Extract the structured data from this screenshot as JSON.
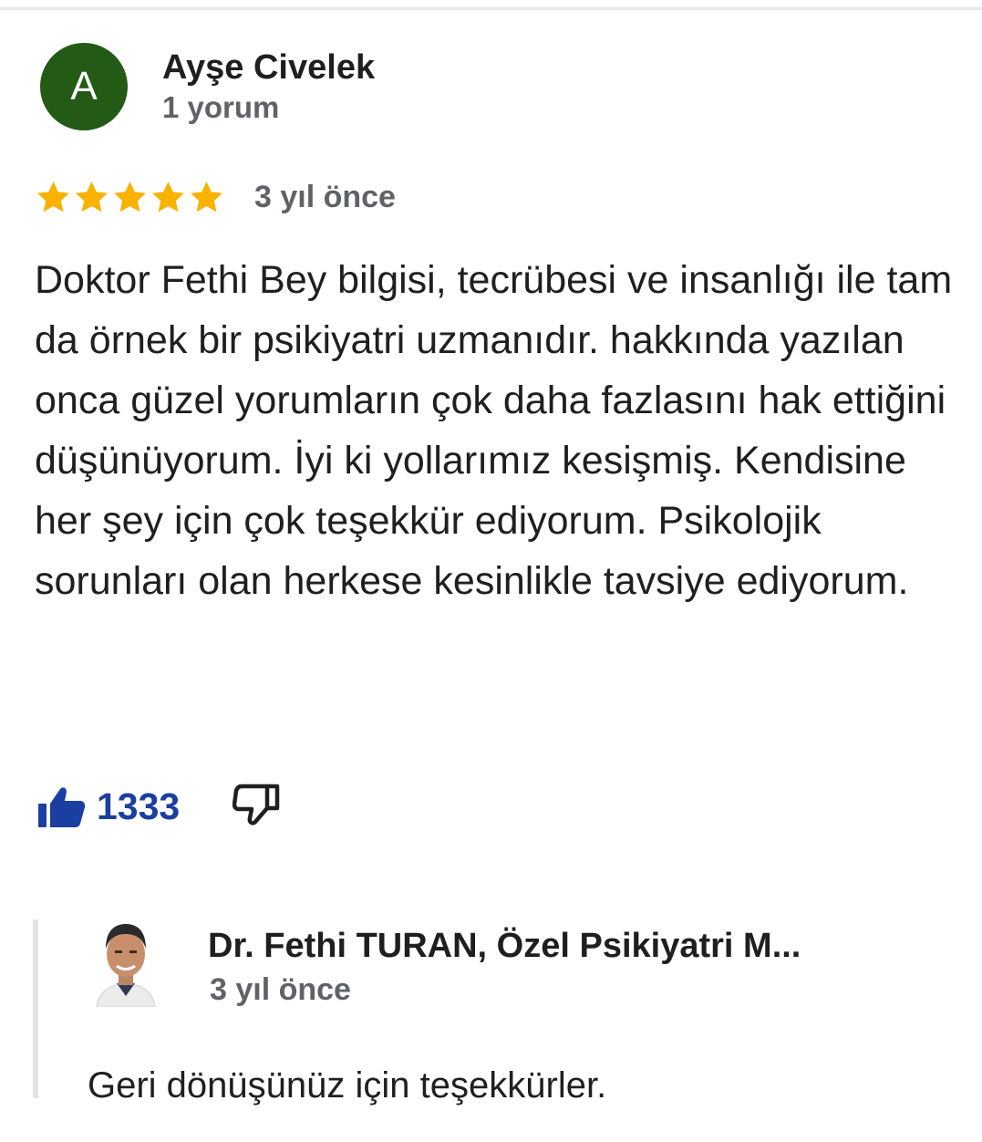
{
  "reviewer": {
    "initial": "A",
    "name": "Ayşe Civelek",
    "review_count": "1 yorum",
    "avatar_color": "#235b16"
  },
  "review": {
    "rating_stars": 5,
    "star_color": "#f9b200",
    "time": "3 yıl önce",
    "text": "Doktor Fethi Bey bilgisi, tecrübesi ve insanlığı ile tam da örnek bir psikiyatri uzmanıdır. hakkında yazılan onca güzel yorumların çok daha fazlasını hak ettiğini düşünüyorum. İyi ki yollarımız kesişmiş. Kendisine her şey için çok teşekkür ediyorum. Psikolojik sorunları olan herkese kesinlikle tavsiye ediyorum."
  },
  "reactions": {
    "like_icon": "thumbs-up-icon",
    "like_count": "1333",
    "like_color": "#1a3fa0",
    "dislike_icon": "thumbs-down-icon"
  },
  "owner_reply": {
    "name": "Dr. Fethi TURAN, Özel Psikiyatri M...",
    "time": "3 yıl önce",
    "text": "Geri dönüşünüz için teşekkürler."
  }
}
